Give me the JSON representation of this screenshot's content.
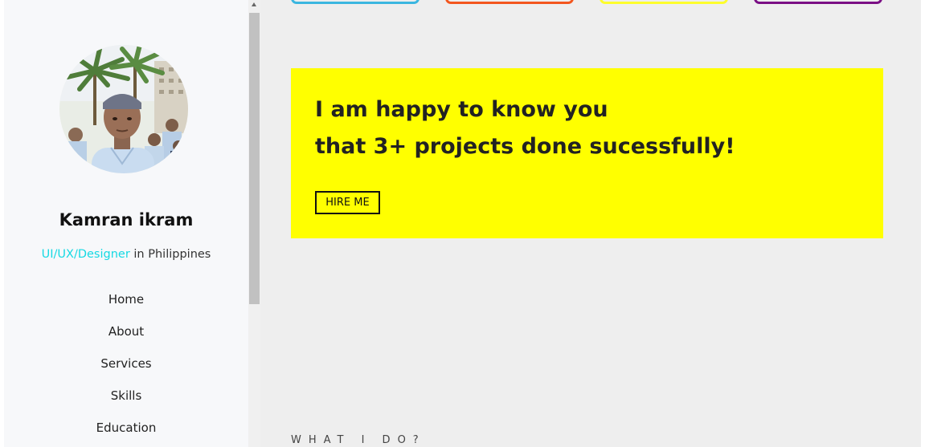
{
  "sidebar": {
    "profile": {
      "name": "Kamran ikram",
      "role": "UI/UX/Designer",
      "location_text": " in Philippines"
    },
    "nav_items": [
      {
        "label": "Home"
      },
      {
        "label": "About"
      },
      {
        "label": "Services"
      },
      {
        "label": "Skills"
      },
      {
        "label": "Education"
      }
    ]
  },
  "main": {
    "color_cards": [
      {
        "name": "blue",
        "color": "#3bb6e0"
      },
      {
        "name": "orange",
        "color": "#f3561e"
      },
      {
        "name": "yellow",
        "color": "#fdfd2c"
      },
      {
        "name": "purple",
        "color": "#7a0f84"
      }
    ],
    "hero": {
      "line1": "I am happy to know you",
      "line2": "that 3+ projects done sucessfully!",
      "button_label": "HIRE ME",
      "background": "#ffff00"
    },
    "section_heading": "WHAT I DO?"
  },
  "theme": {
    "accent": "#16d9e3",
    "sidebar_bg": "#f7f8fa",
    "main_bg": "#eeeeee"
  },
  "icons": {
    "scroll_up": "scroll-up-arrow-icon"
  }
}
